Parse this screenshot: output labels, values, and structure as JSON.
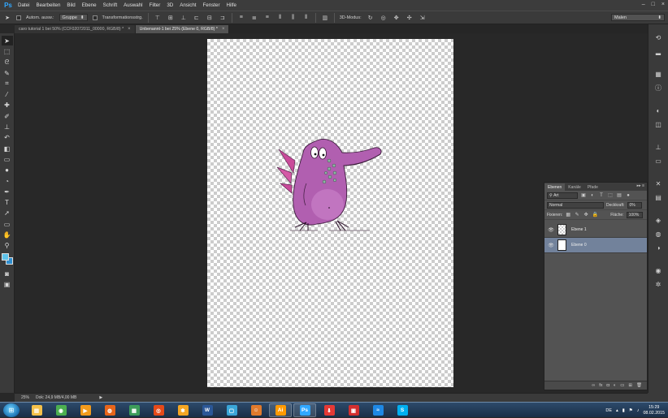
{
  "app": {
    "logo": "Ps"
  },
  "menu": [
    "Datei",
    "Bearbeiten",
    "Bild",
    "Ebene",
    "Schrift",
    "Auswahl",
    "Filter",
    "3D",
    "Ansicht",
    "Fenster",
    "Hilfe"
  ],
  "window_controls": [
    "–",
    "□",
    "×"
  ],
  "options": {
    "auto_select_label": "Autom. ausw.:",
    "auto_select_target": "Gruppe",
    "transform_label": "Transformationsstrg.",
    "mode_3d_label": "3D-Modus:",
    "workspace": "Malen"
  },
  "tabs": [
    {
      "label": "caro tutorial 1 bei 50% (CCF02072011_00000, RGB/8) *",
      "active": false
    },
    {
      "label": "Unbenannt-1 bei 25% (Ebene 0, RGB/8) *",
      "active": true
    }
  ],
  "tab_close": "×",
  "colors": {
    "foreground": "#5ec3ea",
    "background": "#2f8fd0",
    "selected_layer": "#72829b",
    "monster": "#b15fb0"
  },
  "layers_panel": {
    "tabs": [
      "Ebenen",
      "Kanäle",
      "Pfade"
    ],
    "menu": "▸▸ ≡",
    "filter_kind": "Art",
    "blend_mode": "Normal",
    "opacity_label": "Deckkraft:",
    "opacity_value": "0%",
    "lock_label": "Fixieren:",
    "fill_label": "Fläche:",
    "fill_value": "100%",
    "layers": [
      {
        "name": "Ebene 1",
        "selected": false,
        "thumb": "transparent"
      },
      {
        "name": "Ebene 0",
        "selected": true,
        "thumb": "white"
      }
    ],
    "footer_icons": [
      "link-icon",
      "fx-icon",
      "mask-icon",
      "adjustment-icon",
      "folder-icon",
      "new-layer-icon",
      "trash-icon"
    ],
    "footer_fx": "fx"
  },
  "status": {
    "zoom": "25%",
    "doc_info": "Dok: 24,9 MB/4,00 MB",
    "arrow": "▶"
  },
  "taskbar": {
    "apps": [
      {
        "name": "explorer-icon",
        "label": "▤",
        "color": "#f3c04a"
      },
      {
        "name": "chrome-icon",
        "label": "◉",
        "color": "#4caf50"
      },
      {
        "name": "media-player-icon",
        "label": "▶",
        "color": "#f29b1d"
      },
      {
        "name": "firefox-icon",
        "label": "◍",
        "color": "#e8651a"
      },
      {
        "name": "photos-icon",
        "label": "▦",
        "color": "#3d9c5a"
      },
      {
        "name": "spiral-app-icon",
        "label": "◎",
        "color": "#e64a19"
      },
      {
        "name": "tools-app-icon",
        "label": "✱",
        "color": "#f5a623"
      },
      {
        "name": "word-icon",
        "label": "W",
        "color": "#2b5797"
      },
      {
        "name": "contacts-icon",
        "label": "▢",
        "color": "#3aa6d8"
      },
      {
        "name": "character-app-icon",
        "label": "☺",
        "color": "#e07a2c"
      },
      {
        "name": "illustrator-icon",
        "label": "Ai",
        "color": "#ff9a00"
      },
      {
        "name": "photoshop-icon",
        "label": "Ps",
        "color": "#31a8ff"
      },
      {
        "name": "download-icon",
        "label": "⬇",
        "color": "#e53935"
      },
      {
        "name": "pdf-icon",
        "label": "▣",
        "color": "#d32f2f"
      },
      {
        "name": "wave-app-icon",
        "label": "≈",
        "color": "#1e88e5"
      },
      {
        "name": "skype-icon",
        "label": "S",
        "color": "#00aff0"
      }
    ],
    "open_apps": [
      10,
      11
    ],
    "lang": "DE",
    "time": "15:29",
    "date": "08.02.2015"
  }
}
